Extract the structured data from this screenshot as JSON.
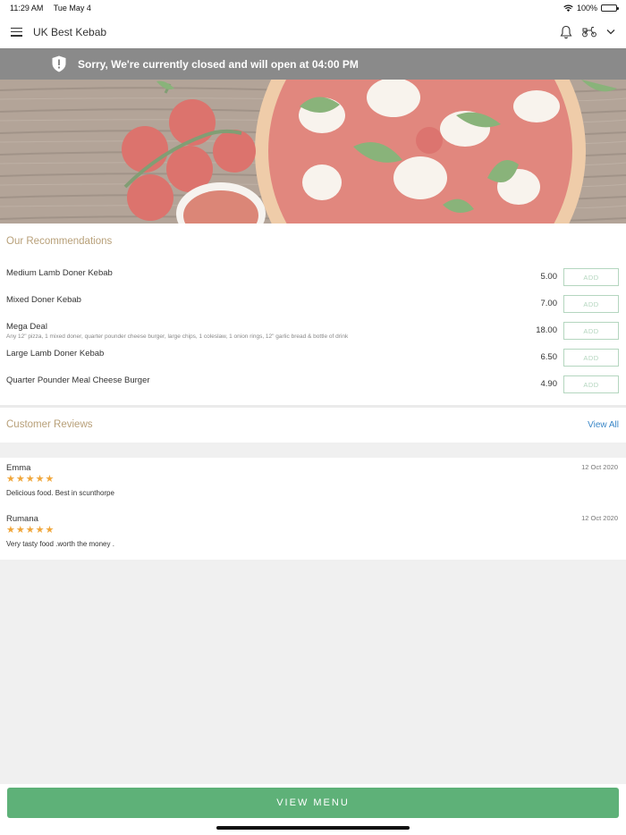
{
  "status_bar": {
    "time": "11:29 AM",
    "date": "Tue May 4",
    "battery": "100%"
  },
  "header": {
    "title": "UK Best Kebab",
    "icons": [
      "menu-icon",
      "bell-icon",
      "scooter-icon",
      "chevron-down-icon"
    ]
  },
  "banner": {
    "text": "Sorry, We're currently closed and will open at 04:00 PM",
    "icon": "shield-icon"
  },
  "recommendations": {
    "title": "Our Recommendations",
    "items": [
      {
        "name": "Medium Lamb Doner Kebab",
        "description": "",
        "price": "5.00",
        "button": "ADD"
      },
      {
        "name": "Mixed Doner Kebab",
        "description": "",
        "price": "7.00",
        "button": "ADD"
      },
      {
        "name": "Mega Deal",
        "description": "Any 12\" pizza, 1 mixed doner, quarter pounder cheese burger, large chips, 1 coleslaw, 1 onion rings, 12\" garlic bread & bottle of drink",
        "price": "18.00",
        "button": "ADD"
      },
      {
        "name": "Large Lamb Doner Kebab",
        "description": "",
        "price": "6.50",
        "button": "ADD"
      },
      {
        "name": "Quarter Pounder Meal Cheese Burger",
        "description": "",
        "price": "4.90",
        "button": "ADD"
      }
    ]
  },
  "reviews": {
    "title": "Customer Reviews",
    "view_all": "View All",
    "items": [
      {
        "name": "Emma",
        "date": "12 Oct 2020",
        "rating": 5,
        "text": "Delicious food. Best in scunthorpe"
      },
      {
        "name": "Rumana",
        "date": "12 Oct 2020",
        "rating": 5,
        "text": "Very tasty food .worth the money ."
      }
    ]
  },
  "footer": {
    "view_menu": "VIEW MENU"
  },
  "colors": {
    "banner_bg": "#8a8a8a",
    "section_title": "#b8a079",
    "link": "#3a87c7",
    "primary_button": "#5eb178",
    "add_button_border": "#b4d6bf",
    "star": "#f0a63a"
  }
}
